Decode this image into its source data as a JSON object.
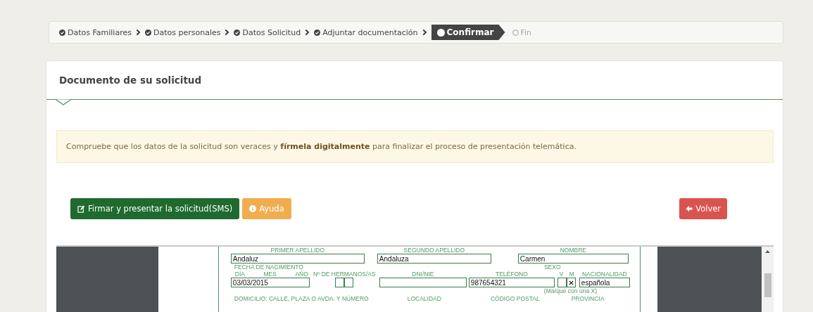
{
  "breadcrumb": {
    "steps": [
      {
        "label": "Datos Familiares",
        "done": true,
        "selected": false
      },
      {
        "label": "Datos personales",
        "done": true,
        "selected": false
      },
      {
        "label": "Datos Solicitud",
        "done": true,
        "selected": false
      },
      {
        "label": "Adjuntar documentación",
        "done": true,
        "selected": false
      },
      {
        "label": "Confirmar",
        "done": false,
        "selected": true
      },
      {
        "label": "Fin",
        "done": false,
        "selected": false
      }
    ]
  },
  "card": {
    "title": "Documento de su solicitud"
  },
  "alert": {
    "text": "Compruebe que los datos de la solicitud son veraces y **fírmela digitalmente** para finalizar el proceso de presentación telemática."
  },
  "buttons": [
    {
      "label": "Firmar y presentar la solicitud(SMS)",
      "kind": "sign"
    },
    {
      "label": "Ayuda",
      "kind": "help"
    },
    {
      "label": "Volver",
      "kind": "back"
    }
  ],
  "document": {
    "name_fields": [
      {
        "label": "PRIMER APELLIDO",
        "value": "Andaluz"
      },
      {
        "label": "SEGUNDO APELLIDO",
        "value": "Andaluza"
      },
      {
        "label": "NOMBRE",
        "value": "Carmen"
      }
    ],
    "birth_date": {
      "label": "FECHA DE NACIMIENTO",
      "parts": [
        "DÍA",
        "MES",
        "AÑO"
      ],
      "value": "03/03/2015"
    },
    "siblings": {
      "label": "Nº DE HERMANOS/AS"
    },
    "dni": {
      "label": "DNI/NIE"
    },
    "phone": {
      "label": "TELÉFONO",
      "value": "987654321"
    },
    "sex": {
      "label": "SEXO",
      "options": [
        {
          "label": "V",
          "checked": false
        },
        {
          "label": "M",
          "checked": true
        }
      ],
      "hint": "(Marque con una X)"
    },
    "nationality": {
      "label": "NACIONALIDAD",
      "value": "española"
    },
    "address_labels": [
      "DOMICILIO: CALLE, PLAZA O AVDA. Y NÚMERO",
      "LOCALIDAD",
      "CÓDIGO POSTAL",
      "PROVINCIA"
    ]
  }
}
